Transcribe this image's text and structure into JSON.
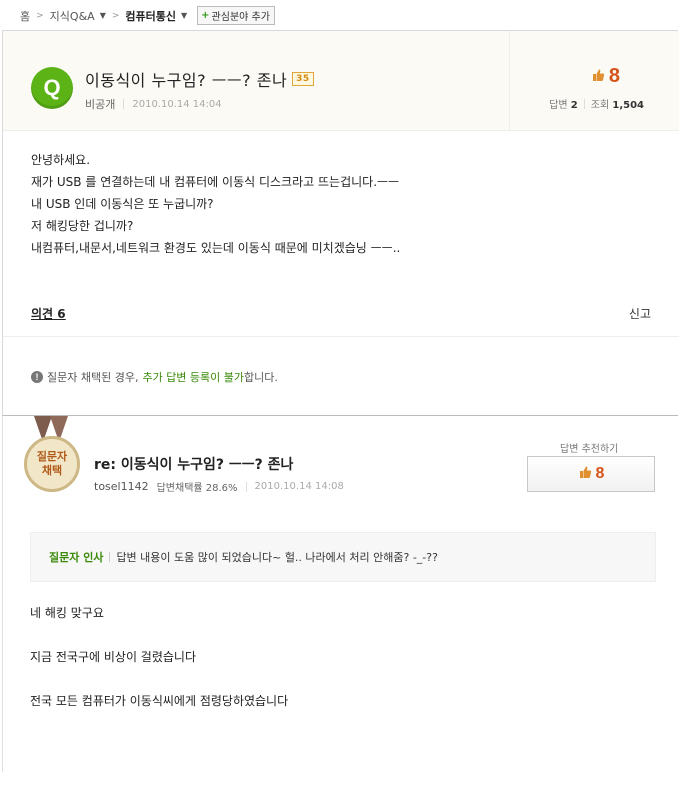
{
  "breadcrumb": {
    "home": "홈",
    "qna": "지식Q&A",
    "category": "컴퓨터통신",
    "add_interest": "관심분야 추가"
  },
  "question": {
    "badge": "Q",
    "title": "이동식이 누구임? ㅡㅡ? 존나",
    "points": "35",
    "author": "비공개",
    "date": "2010.10.14 14:04",
    "recommend_count": "8",
    "answers_label": "답변",
    "answers": "2",
    "views_label": "조회",
    "views": "1,504",
    "body": [
      "안녕하세요.",
      "재가 USB 를 연결하는데 내 컴퓨터에 이동식 디스크라고 뜨는겁니다.ㅡㅡ",
      "내 USB 인데 이동식은 또 누굽니까?",
      "저 해킹당한 겁니까?",
      "내컴퓨터,내문서,네트워크 환경도 있는데 이동식 때문에 미치겠습닝 ㅡㅡ.."
    ],
    "opinion_label": "의견",
    "opinion_count": "6",
    "report": "신고",
    "notice_prefix": "질문자 채택된 경우,",
    "notice_highlight": "추가 답변 등록이 불가",
    "notice_suffix": "합니다."
  },
  "answer": {
    "medal_line1": "질문자",
    "medal_line2": "채택",
    "title": "re: 이동식이 누구임? ㅡㅡ? 존나",
    "author": "tosel1142",
    "adopt_rate": "답변채택률 28.6%",
    "date": "2010.10.14 14:08",
    "recommend_label": "답변 추천하기",
    "recommend_count": "8",
    "thanks_label": "질문자 인사",
    "thanks_text": "답변 내용이 도움 많이 되었습니다~ 헐.. 나라에서 처리 안해줌? -_-??",
    "body": [
      "네 해킹 맞구요",
      "지금 전국구에 비상이 걸렸습니다",
      "전국 모든 컴퓨터가 이동식씨에게 점령당하였습니다"
    ]
  },
  "colors": {
    "accent_green": "#5bb316",
    "recommend_orange": "#d5541a",
    "medal_text": "#b05a18"
  },
  "icons": {
    "question_badge": "q-badge-icon",
    "thumb": "thumbs-up-icon",
    "info": "info-icon",
    "medal": "medal-icon"
  }
}
